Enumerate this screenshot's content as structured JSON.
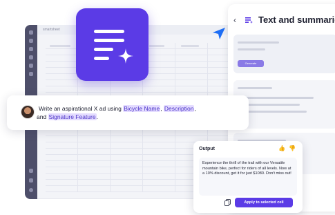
{
  "sheet": {
    "brand": "smartsheet"
  },
  "panel": {
    "back_glyph": "‹",
    "title": "Text and summaries",
    "generate_label": "Generate"
  },
  "prompt": {
    "text_before": "Write an aspirational X ad using ",
    "chip_1": "Bicycle Name",
    "sep_1": ", ",
    "chip_2": "Description",
    "sep_2": ",",
    "text_and": " and ",
    "chip_3": "Signature Feature",
    "text_end": "."
  },
  "output": {
    "label": "Output",
    "text": "Experience the thrill of the trail with our Versatile mountain bike, perfect for riders of all levels. Now at a 10% discount, get it for just $1080. Don't miss out!",
    "apply_label": "Apply to selected cell",
    "thumbs_up_glyph": "👍",
    "thumbs_down_glyph": "👎"
  },
  "colors": {
    "accent": "#5b3be6",
    "chip_bg": "#e4dcff"
  }
}
